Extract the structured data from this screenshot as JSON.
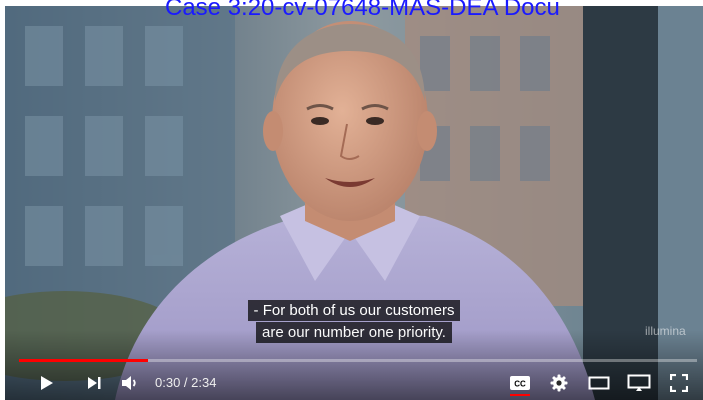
{
  "document_header": "Case 3:20-cv-07648-MAS-DEA   Docu",
  "video": {
    "subtitle_lines": [
      "- For both of us our customers",
      "are our number one priority."
    ],
    "watermark": "illumina"
  },
  "player_controls": {
    "progress_fraction": 0.19,
    "current_time": "0:30",
    "duration": "2:34",
    "time_separator": " / ",
    "cc_label": "CC",
    "accent_color": "#ff0000"
  },
  "icons": [
    "play-icon",
    "next-icon",
    "volume-icon",
    "cc-icon",
    "settings-gear-icon",
    "theater-mode-icon",
    "miniplayer-icon",
    "fullscreen-icon"
  ]
}
